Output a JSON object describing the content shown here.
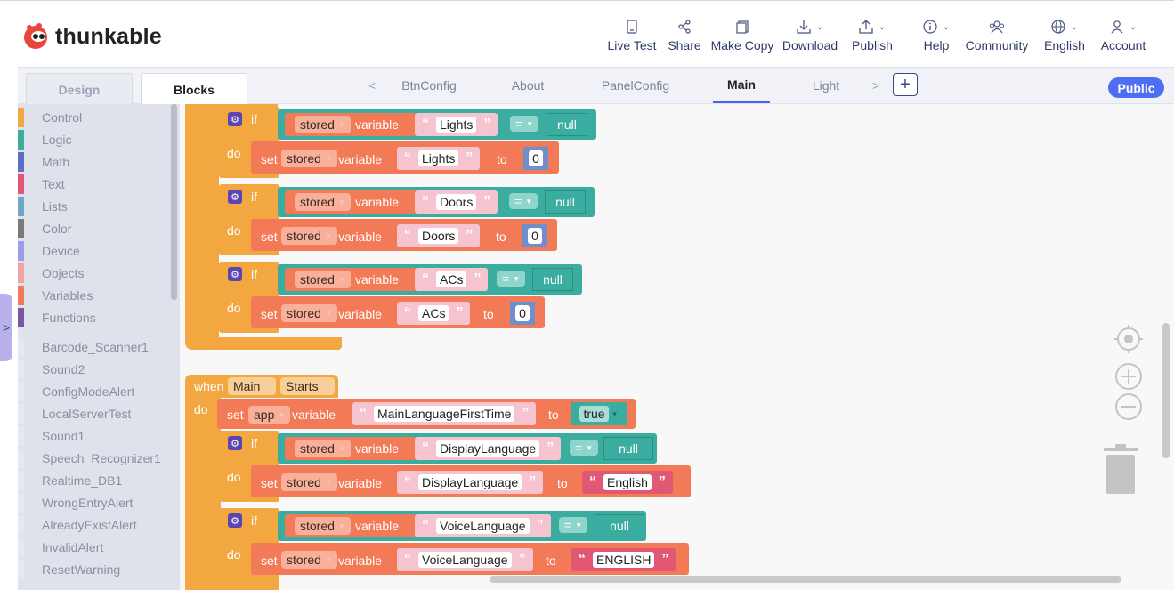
{
  "header": {
    "brand": "thunkable",
    "nav": [
      {
        "label": "Live Test",
        "icon": "phone-icon"
      },
      {
        "label": "Share",
        "icon": "share-icon"
      },
      {
        "label": "Make Copy",
        "icon": "copy-icon"
      },
      {
        "label": "Download",
        "icon": "download-icon"
      },
      {
        "label": "Publish",
        "icon": "publish-icon"
      },
      {
        "label": "Help",
        "icon": "info-icon"
      },
      {
        "label": "Community",
        "icon": "community-icon"
      },
      {
        "label": "English",
        "icon": "globe-icon"
      },
      {
        "label": "Account",
        "icon": "user-icon"
      }
    ]
  },
  "tabs": {
    "design": "Design",
    "blocks": "Blocks",
    "screens": [
      "BtnConfig",
      "About",
      "PanelConfig",
      "Main",
      "Light"
    ],
    "active_screen": "Main",
    "public_label": "Public",
    "prev": "<",
    "next": ">",
    "add": "+"
  },
  "sidebar": {
    "categories": [
      {
        "label": "Control",
        "color": "#f2a740"
      },
      {
        "label": "Logic",
        "color": "#3aada0"
      },
      {
        "label": "Math",
        "color": "#5b6fc4"
      },
      {
        "label": "Text",
        "color": "#e25774"
      },
      {
        "label": "Lists",
        "color": "#6ea8c4"
      },
      {
        "label": "Color",
        "color": "#7a7a7a"
      },
      {
        "label": "Device",
        "color": "#9c9cec"
      },
      {
        "label": "Objects",
        "color": "#f2a3a6"
      },
      {
        "label": "Variables",
        "color": "#f37a57"
      },
      {
        "label": "Functions",
        "color": "#7757a8"
      }
    ],
    "components": [
      "Barcode_Scanner1",
      "Sound2",
      "ConfigModeAlert",
      "LocalServerTest",
      "Sound1",
      "Speech_Recognizer1",
      "Realtime_DB1",
      "WrongEntryAlert",
      "AlreadyExistAlert",
      "InvalidAlert",
      "ResetWarning"
    ]
  },
  "blocks": {
    "kw_if": "if",
    "kw_do": "do",
    "kw_set": "set",
    "kw_to": "to",
    "kw_variable": "variable",
    "kw_when": "when",
    "stored": "stored",
    "app": "app",
    "eq": "=",
    "null": "null",
    "zero": "0",
    "true": "true",
    "event_screen": "Main",
    "event_name": "Starts",
    "vars": [
      "Lights",
      "Doors",
      "ACs"
    ],
    "main_lang_first": "MainLanguageFirstTime",
    "display_language": "DisplayLanguage",
    "voice_language": "VoiceLanguage",
    "english_text": "English",
    "english_caps": "ENGLISH",
    "quote_open": "“",
    "quote_close": "”"
  }
}
